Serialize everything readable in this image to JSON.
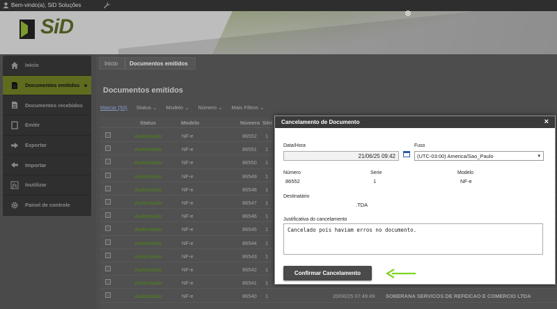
{
  "topbar": {
    "welcome": "Bem-vindo(a), SiD Soluções"
  },
  "brand": {
    "logo_text": "SiD",
    "accent": "#8cc63f"
  },
  "sidebar": {
    "items": [
      {
        "label": "Início",
        "icon": "home-icon"
      },
      {
        "label": "Documentos emitidos",
        "icon": "document-icon",
        "active": true
      },
      {
        "label": "Documentos recebidos",
        "icon": "document-icon"
      },
      {
        "label": "Emitir",
        "icon": "page-icon"
      },
      {
        "label": "Exportar",
        "icon": "arrow-right-icon"
      },
      {
        "label": "Importar",
        "icon": "arrow-left-icon"
      },
      {
        "label": "Inutilizar",
        "icon": "fx-icon"
      },
      {
        "label": "Painel de controle",
        "icon": "gear-icon"
      }
    ]
  },
  "breadcrumb": {
    "home": "Início",
    "current": "Documentos emitidos"
  },
  "page": {
    "title": "Documentos emitidos"
  },
  "filters": {
    "mark": "Marcar (50)",
    "status": "Status",
    "modelo": "Modelo",
    "numero": "Número",
    "more": "Mais Filtros"
  },
  "table": {
    "headers": {
      "status": "Status",
      "modelo": "Modelo",
      "numero": "Número",
      "serie": "Séri"
    },
    "rows": [
      {
        "status": "Autorizado",
        "modelo": "NF-e",
        "numero": "86552",
        "serie": "1"
      },
      {
        "status": "Autorizado",
        "modelo": "NF-e",
        "numero": "86551",
        "serie": "1"
      },
      {
        "status": "Autorizado",
        "modelo": "NF-e",
        "numero": "86550",
        "serie": "1"
      },
      {
        "status": "Autorizado",
        "modelo": "NF-e",
        "numero": "86549",
        "serie": "1"
      },
      {
        "status": "Autorizado",
        "modelo": "NF-e",
        "numero": "86548",
        "serie": "1"
      },
      {
        "status": "Autorizado",
        "modelo": "NF-e",
        "numero": "86547",
        "serie": "1"
      },
      {
        "status": "Autorizado",
        "modelo": "NF-e",
        "numero": "86546",
        "serie": "1"
      },
      {
        "status": "Autorizado",
        "modelo": "NF-e",
        "numero": "86545",
        "serie": "1"
      },
      {
        "status": "Autorizado",
        "modelo": "NF-e",
        "numero": "86544",
        "serie": "1"
      },
      {
        "status": "Autorizado",
        "modelo": "NF-e",
        "numero": "86543",
        "serie": "1"
      },
      {
        "status": "Autorizado",
        "modelo": "NF-e",
        "numero": "86542",
        "serie": "1"
      },
      {
        "status": "Autorizado",
        "modelo": "NF-e",
        "numero": "86541",
        "serie": "1"
      },
      {
        "status": "Autorizado",
        "modelo": "NF-e",
        "numero": "86540",
        "serie": "1",
        "date": "20/06/25 07:49:49",
        "dest": "SOBERANA SERVICOS DE REFEICAO E COMERCIO LTDA"
      }
    ]
  },
  "modal": {
    "title": "Cancelamento de Documento",
    "close": "×",
    "date_label": "Data/Hora",
    "date_value": "21/06/25 09:42",
    "fuso_label": "Fuso",
    "fuso_value": "(UTC-03:00) America/Sao_Paulo",
    "numero_label": "Número",
    "numero_value": "86552",
    "serie_label": "Serie",
    "serie_value": "1",
    "modelo_label": "Modelo",
    "modelo_value": "NF-e",
    "dest_label": "Destinatário",
    "dest_value": ".TDA",
    "just_label": "Justificativa do cancelamento",
    "just_value": "Cancelado pois haviam erros no documento.",
    "confirm": "Confirmar Cancelamento"
  }
}
